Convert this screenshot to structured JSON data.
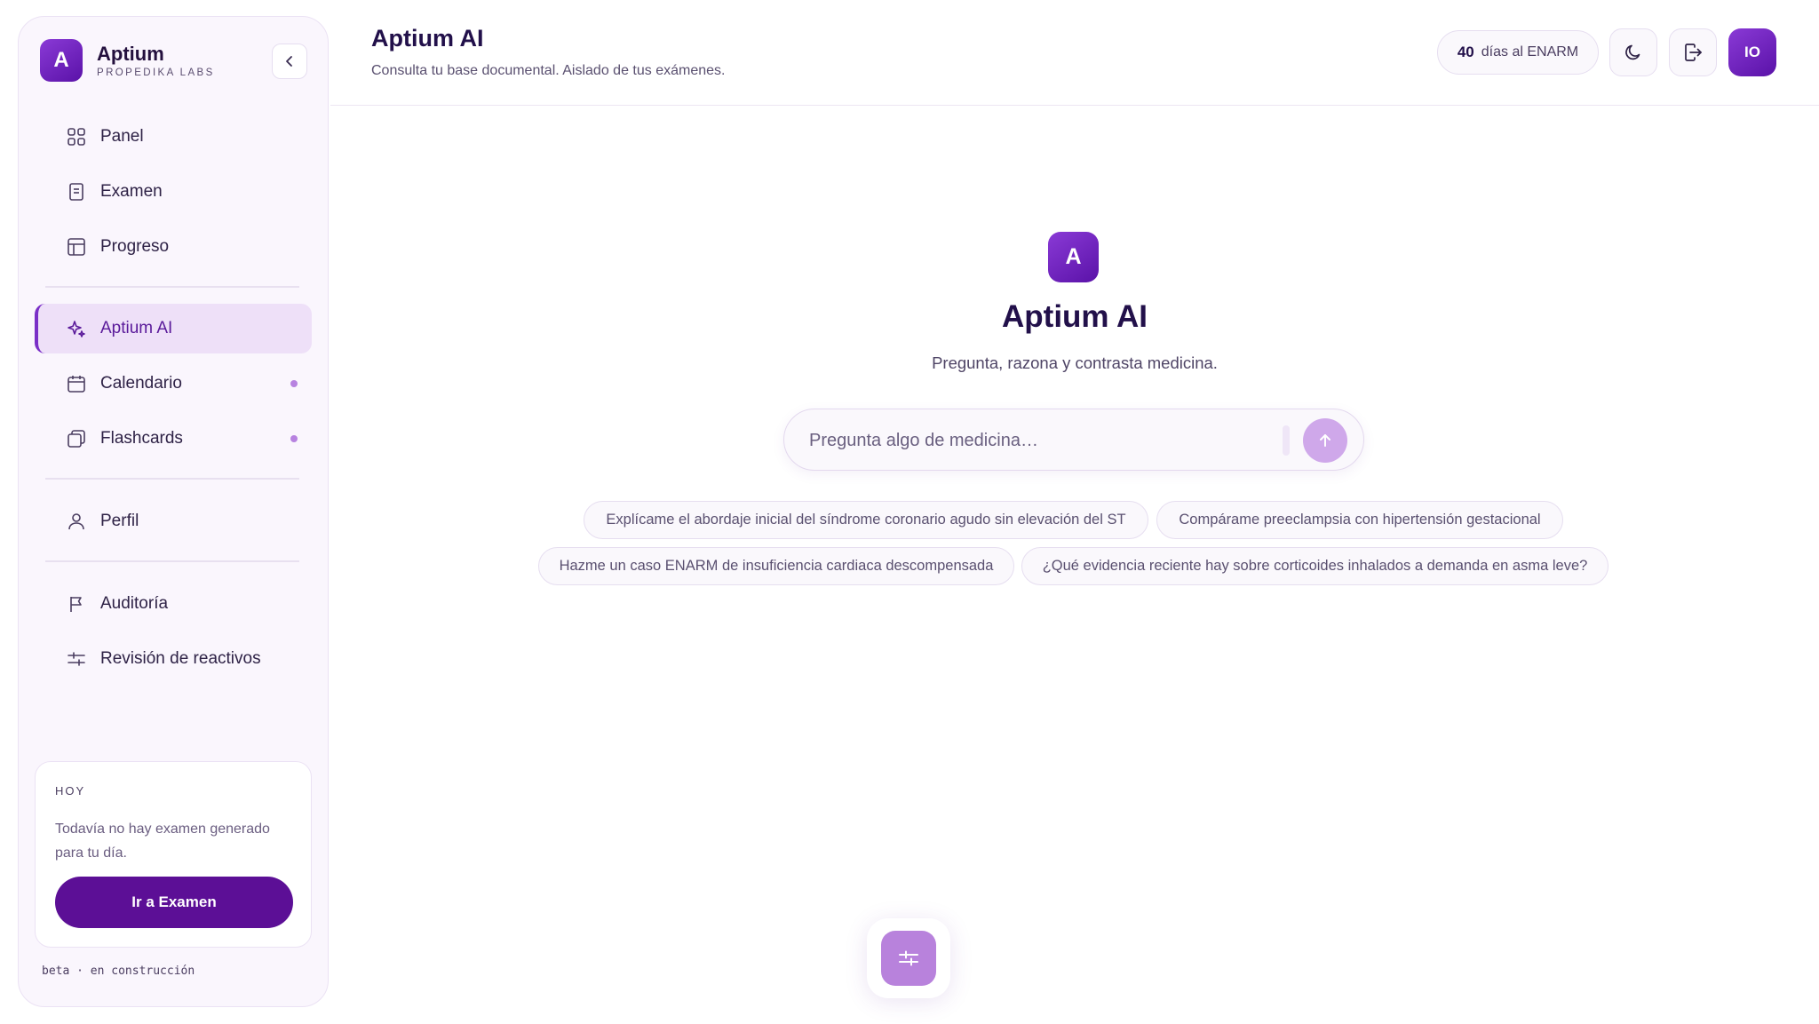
{
  "brand": {
    "logo_letter": "A",
    "name": "Aptium",
    "subtitle": "PROPEDIKA LABS"
  },
  "sidebar": {
    "items": [
      {
        "label": "Panel",
        "icon": "grid-icon"
      },
      {
        "label": "Examen",
        "icon": "document-icon"
      },
      {
        "label": "Progreso",
        "icon": "layout-icon"
      },
      {
        "label": "Aptium AI",
        "icon": "sparkles-icon",
        "active": true
      },
      {
        "label": "Calendario",
        "icon": "calendar-icon",
        "dot": true
      },
      {
        "label": "Flashcards",
        "icon": "cards-icon",
        "dot": true
      },
      {
        "label": "Perfil",
        "icon": "user-icon"
      },
      {
        "label": "Auditoría",
        "icon": "flag-icon"
      },
      {
        "label": "Revisión de reactivos",
        "icon": "sliders-icon"
      }
    ],
    "today": {
      "label": "HOY",
      "text": "Todavía no hay examen generado para tu día.",
      "button_label": "Ir a Examen"
    },
    "footer": "beta · en construcción"
  },
  "header": {
    "title": "Aptium AI",
    "subtitle": "Consulta tu base documental. Aislado de tus exámenes.",
    "days_count": "40",
    "days_label": "días al ENARM",
    "avatar_initials": "IO"
  },
  "main": {
    "logo_letter": "A",
    "title": "Aptium AI",
    "subtitle": "Pregunta, razona y contrasta medicina.",
    "input_placeholder": "Pregunta algo de medicina…",
    "suggestions": [
      "Explícame el abordaje inicial del síndrome coronario agudo sin elevación del ST",
      "Compárame preeclampsia con hipertensión gestacional",
      "Hazme un caso ENARM de insuficiencia cardiaca descompensada",
      "¿Qué evidencia reciente hay sobre corticoides inhalados a demanda en asma leve?"
    ]
  },
  "colors": {
    "accent": "#5c0f96",
    "brand_gradient_start": "#8a3ad6",
    "brand_gradient_end": "#5a12a8",
    "active_bg": "#eee0f8",
    "send_button": "#cfa8ea",
    "fab": "#b882dc"
  }
}
